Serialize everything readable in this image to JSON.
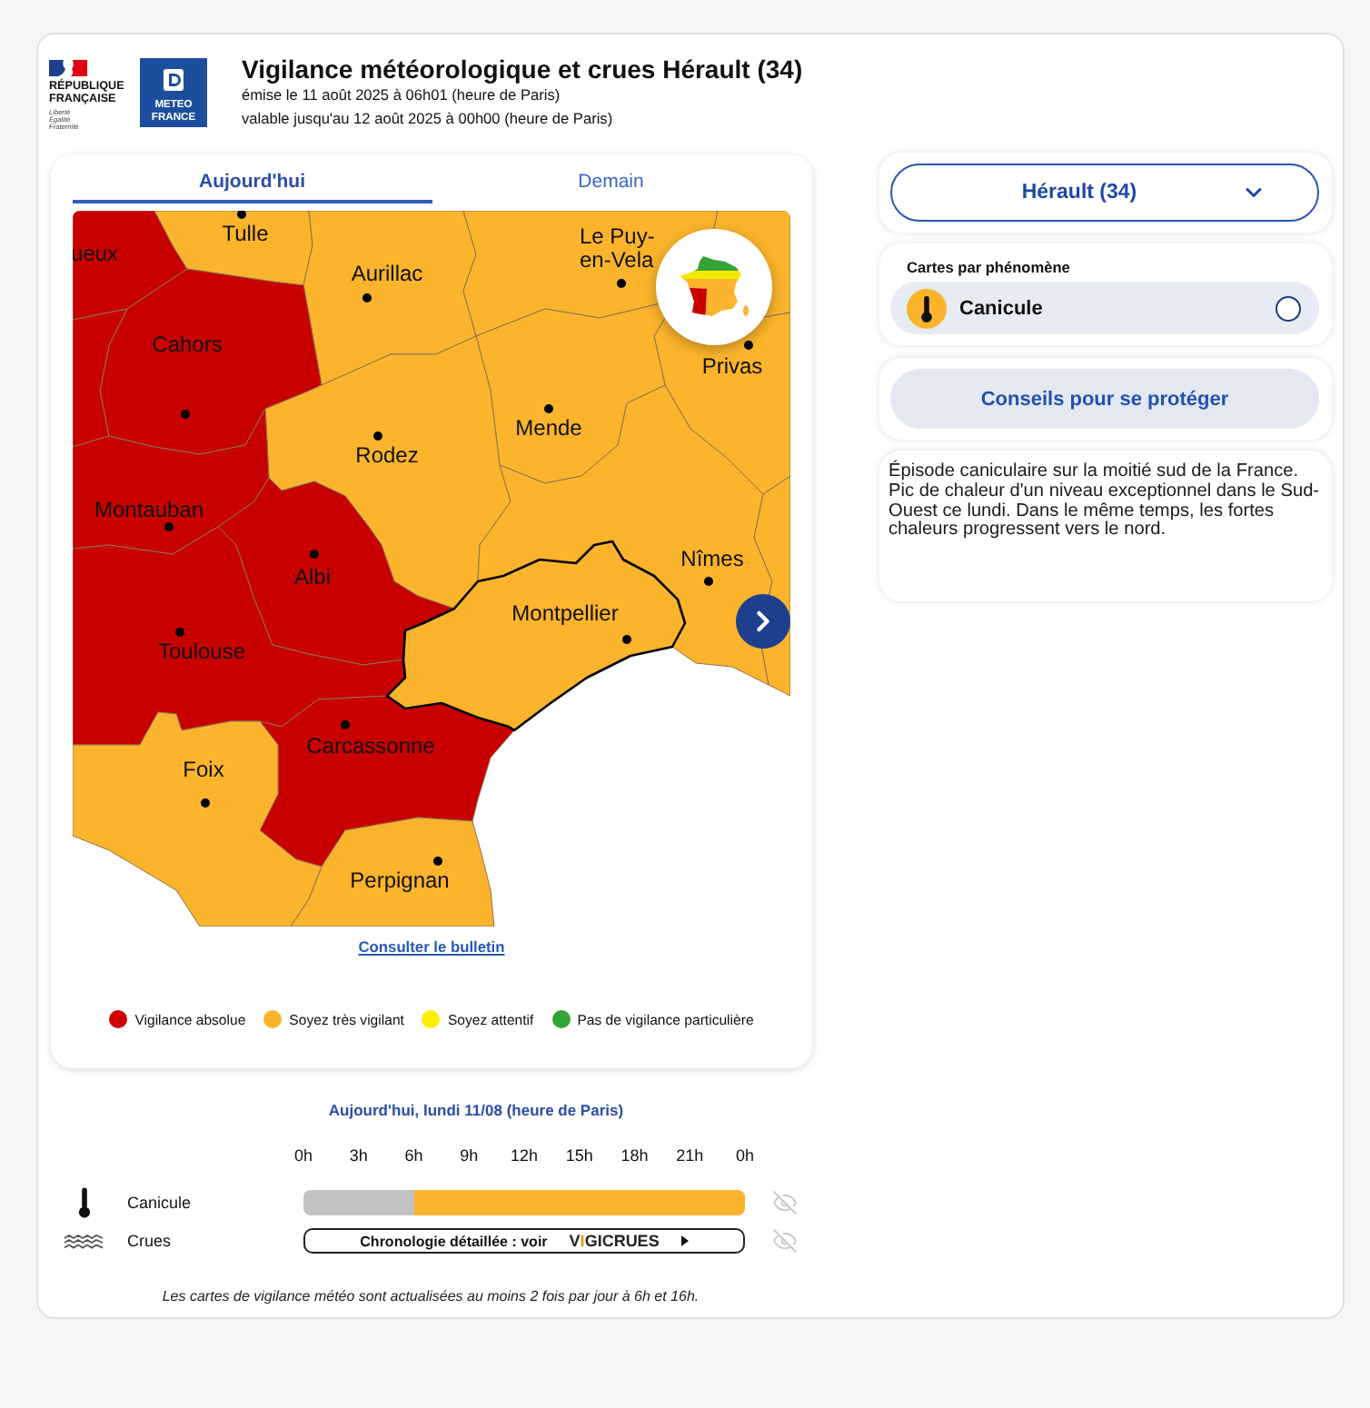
{
  "header": {
    "republic_logo": {
      "name": "RÉPUBLIQUE FRANÇAISE",
      "motto": "Liberté Égalité Fraternité"
    },
    "agency_logo": "METEO FRANCE",
    "title": "Vigilance météorologique et crues Hérault (34)",
    "issued": "émise le 11 août 2025 à 06h01 (heure de Paris)",
    "valid_until": "valable jusqu'au 12 août 2025 à 00h00 (heure de Paris)"
  },
  "map_card": {
    "tabs": [
      {
        "label": "Aujourd'hui",
        "selected": true
      },
      {
        "label": "Demain",
        "selected": false
      }
    ],
    "map": {
      "departments": [
        {
          "city": "ueux",
          "color": "#c80000",
          "selected": false
        },
        {
          "city": "Tulle",
          "color": "#fbb42b",
          "selected": false
        },
        {
          "city": "Aurillac",
          "color": "#fbb42b",
          "selected": false
        },
        {
          "city": "Le Puy-en-Vela",
          "color": "#fbb42b",
          "selected": false
        },
        {
          "color": "#fbb42b",
          "selected": false
        },
        {
          "city": "Privas",
          "color": "#fbb42b",
          "selected": false
        },
        {
          "city": "Mende",
          "color": "#fbb42b",
          "selected": false
        },
        {
          "city": "Cahors",
          "color": "#c80000",
          "selected": false
        },
        {
          "color": "#c80000",
          "selected": false
        },
        {
          "city": "Rodez",
          "color": "#fbb42b",
          "selected": false
        },
        {
          "city": "Montauban",
          "color": "#c80000",
          "selected": false
        },
        {
          "city": "Albi",
          "color": "#c80000",
          "selected": false
        },
        {
          "city": "Toulouse",
          "color": "#c80000",
          "selected": false
        },
        {
          "city": "Nîmes",
          "color": "#fbb42b",
          "selected": false
        },
        {
          "color": "#fbb42b",
          "selected": false
        },
        {
          "city": "Montpellier",
          "color": "#fbb42b",
          "selected": true
        },
        {
          "city": "Carcassonne",
          "color": "#c80000",
          "selected": false
        },
        {
          "city": "Foix",
          "color": "#fbb42b",
          "selected": false
        },
        {
          "city": "Perpignan",
          "color": "#fbb42b",
          "selected": false
        }
      ]
    },
    "bulletin_link": "Consulter le bulletin",
    "legend": [
      {
        "label": "Vigilance absolue",
        "color": "#cc0000"
      },
      {
        "label": "Soyez très vigilant",
        "color": "#fbb42b"
      },
      {
        "label": "Soyez attentif",
        "color": "#ffee00"
      },
      {
        "label": "Pas de vigilance particulière",
        "color": "#33a534"
      }
    ]
  },
  "timeline": {
    "title": "Aujourd'hui, lundi 11/08 (heure de Paris)",
    "hours": [
      "0h",
      "3h",
      "6h",
      "9h",
      "12h",
      "15h",
      "18h",
      "21h",
      "0h"
    ],
    "rows": [
      {
        "kind": "bar",
        "label": "Canicule",
        "segments": [
          {
            "color": "#c3c3c3",
            "level": 0.25
          },
          {
            "color": "#fbb42b",
            "level": 0.75
          }
        ]
      },
      {
        "kind": "link",
        "label": "Crues",
        "text": "Chronologie détaillée : voir",
        "logo": "VIGICRUES"
      }
    ],
    "note": "Les cartes de vigilance météo sont actualisées au moins 2 fois par jour à 6h et 16h."
  },
  "sidebar": {
    "department_select": "Hérault (34)",
    "phenomena": {
      "heading": "Cartes par phénomène",
      "items": [
        {
          "label": "Canicule",
          "selected": false
        }
      ]
    },
    "advice_button": "Conseils pour se protéger",
    "summary": "Épisode caniculaire sur la moitié sud de la France. Pic de chaleur d'un niveau exceptionnel dans le Sud-Ouest ce lundi. Dans le même temps, les fortes chaleurs progressent vers le nord."
  }
}
